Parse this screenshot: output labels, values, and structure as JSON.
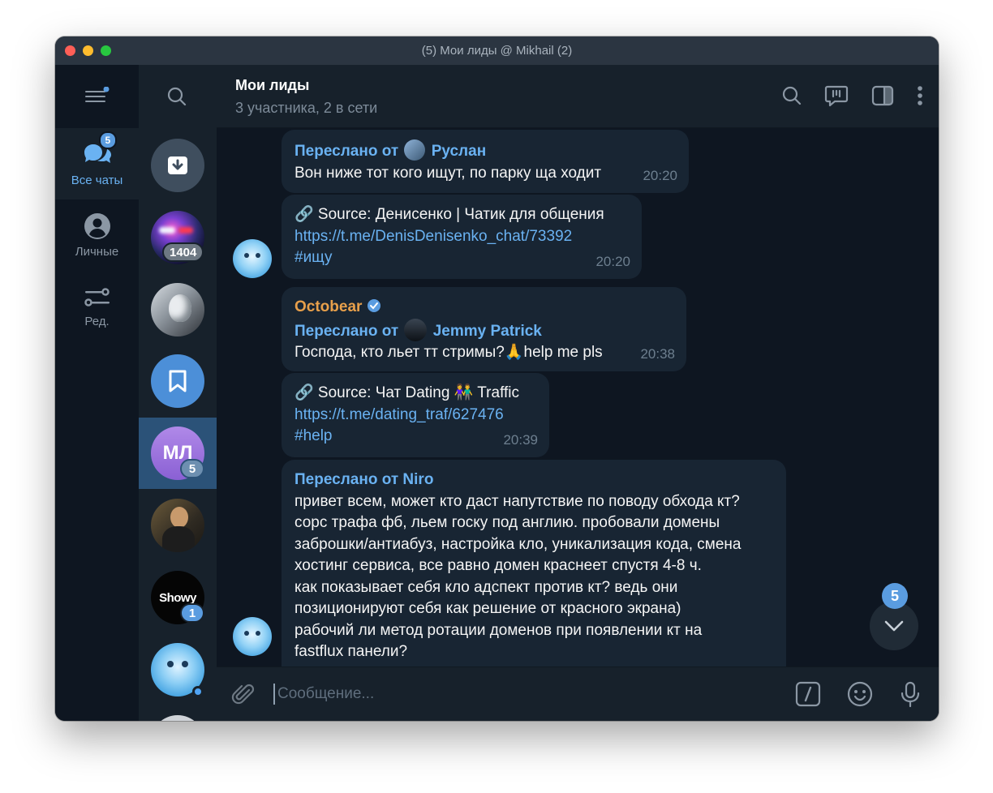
{
  "window": {
    "title": "(5) Мои лиды @ Mikhail (2)"
  },
  "rail": {
    "folders": [
      {
        "label": "Все чаты",
        "badge": "5",
        "icon": "chats-icon"
      },
      {
        "label": "Личные",
        "icon": "person-icon"
      },
      {
        "label": "Ред.",
        "icon": "edit-sliders-icon"
      }
    ]
  },
  "chatlist": {
    "items": [
      {
        "name": "archive",
        "icon": "archive-icon"
      },
      {
        "name": "chat-police",
        "count": "1404"
      },
      {
        "name": "chat-robot"
      },
      {
        "name": "saved-messages",
        "icon": "bookmark-icon"
      },
      {
        "name": "Мои лиды",
        "initials": "МЛ",
        "count": "5",
        "active": true
      },
      {
        "name": "chat-person"
      },
      {
        "name": "chat-showy",
        "initials": "Showy",
        "count": "1"
      },
      {
        "name": "chat-bear"
      }
    ]
  },
  "header": {
    "title": "Мои лиды",
    "subtitle": "3 участника, 2 в сети"
  },
  "messages": [
    {
      "fwd_prefix": "Переслано от",
      "fwd_name": "Руслан",
      "text": "Вон ниже тот кого ищут, по парку ща ходит",
      "time": "20:20"
    },
    {
      "source": "🔗 Source: Денисенко | Чатик для общения",
      "link": "https://t.me/DenisDenisenko_chat/73392",
      "tag": "#ищу",
      "time": "20:20"
    },
    {
      "author": "Octobear",
      "fwd_prefix": "Переслано от",
      "fwd_name": "Jemmy Patrick",
      "text": "Господа, кто льет тт стримы?🙏help me pls",
      "time": "20:38"
    },
    {
      "source": "🔗 Source: Чат Dating 👫 Traffic",
      "link": "https://t.me/dating_traf/627476",
      "tag": "#help",
      "time": "20:39"
    },
    {
      "fwd_full": "Переслано от Niro",
      "lines": [
        "привет всем, может кто даст напутствие по поводу обхода кт?",
        "сорс трафа фб, льем госку под англию. пробовали домены",
        "заброшки/антиабуз, настройка кло, уникализация кода, смена",
        "хостинг сервиса, все равно домен краснеет спустя 4-8 ч.",
        "как показывает себя кло адспект против кт? ведь они",
        "позиционируют себя как решение от красного экрана)",
        "рабочий ли метод ротации доменов при появлении кт на",
        "fastflux панели?"
      ]
    }
  ],
  "scroll": {
    "badge": "5"
  },
  "composer": {
    "placeholder": "Сообщение..."
  },
  "colors": {
    "accent": "#6ab2f2",
    "badge": "#5a9ce0",
    "author": "#e8a04b",
    "bubble": "#182533",
    "bg": "#0e1621"
  }
}
